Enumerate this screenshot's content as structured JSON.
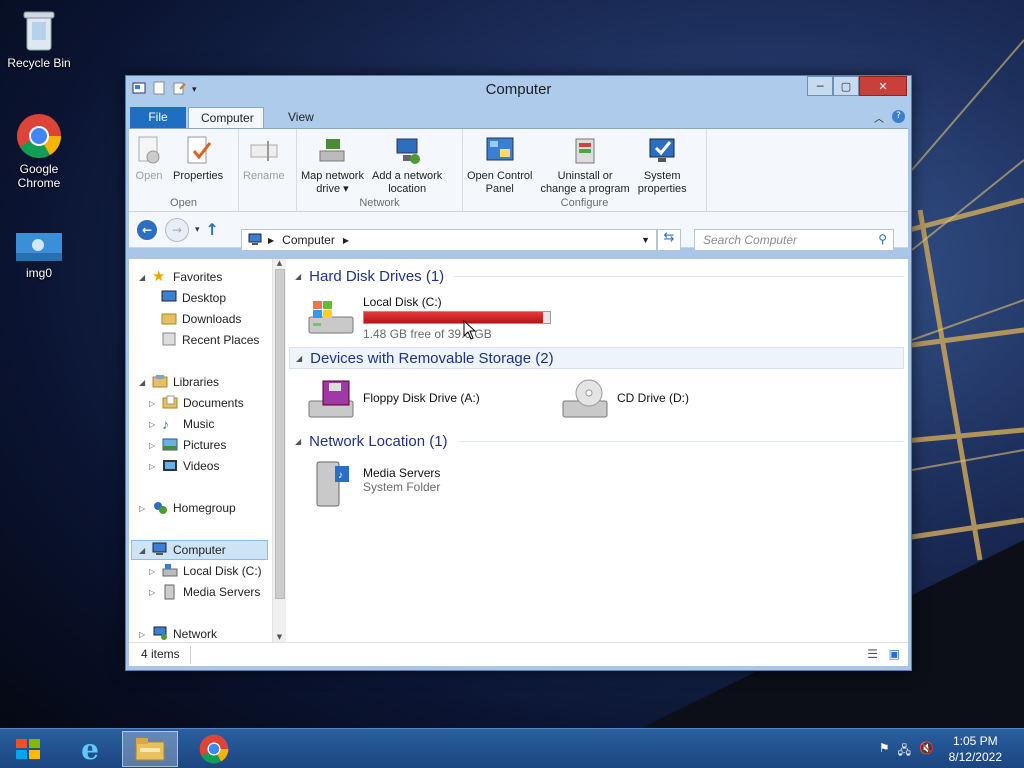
{
  "desktop": {
    "icons": [
      {
        "label": "Recycle Bin"
      },
      {
        "label": "Google Chrome"
      },
      {
        "label": "img0"
      }
    ]
  },
  "window": {
    "title": "Computer",
    "tabs": {
      "file": "File",
      "computer": "Computer",
      "view": "View"
    },
    "ribbon": {
      "open_group": {
        "label": "Open",
        "open": "Open",
        "properties": "Properties",
        "rename": "Rename"
      },
      "network_group": {
        "label": "Network",
        "map_line1": "Map network",
        "map_line2": "drive",
        "add_line1": "Add a network",
        "add_line2": "location"
      },
      "configure_group": {
        "label": "Configure",
        "ocp_line1": "Open Control",
        "ocp_line2": "Panel",
        "uninst_line1": "Uninstall or",
        "uninst_line2": "change a program",
        "sys_line1": "System",
        "sys_line2": "properties"
      }
    },
    "address": {
      "path": "Computer",
      "search_placeholder": "Search Computer"
    },
    "nav": {
      "favorites": "Favorites",
      "desktop": "Desktop",
      "downloads": "Downloads",
      "recent": "Recent Places",
      "libraries": "Libraries",
      "documents": "Documents",
      "music": "Music",
      "pictures": "Pictures",
      "videos": "Videos",
      "homegroup": "Homegroup",
      "computer": "Computer",
      "local_disk": "Local Disk (C:)",
      "media_servers": "Media Servers",
      "network": "Network"
    },
    "sections": {
      "hdd": "Hard Disk Drives (1)",
      "removable": "Devices with Removable Storage (2)",
      "network": "Network Location (1)"
    },
    "items": {
      "local_disk": {
        "name": "Local Disk (C:)",
        "free": "1.48 GB free of 39.6 GB",
        "used_fraction": 0.963
      },
      "floppy": {
        "name": "Floppy Disk Drive (A:)"
      },
      "cd": {
        "name": "CD Drive (D:)"
      },
      "media": {
        "name": "Media Servers",
        "sub": "System Folder"
      }
    },
    "status": "4 items"
  },
  "taskbar": {
    "time": "1:05 PM",
    "date": "8/12/2022"
  }
}
